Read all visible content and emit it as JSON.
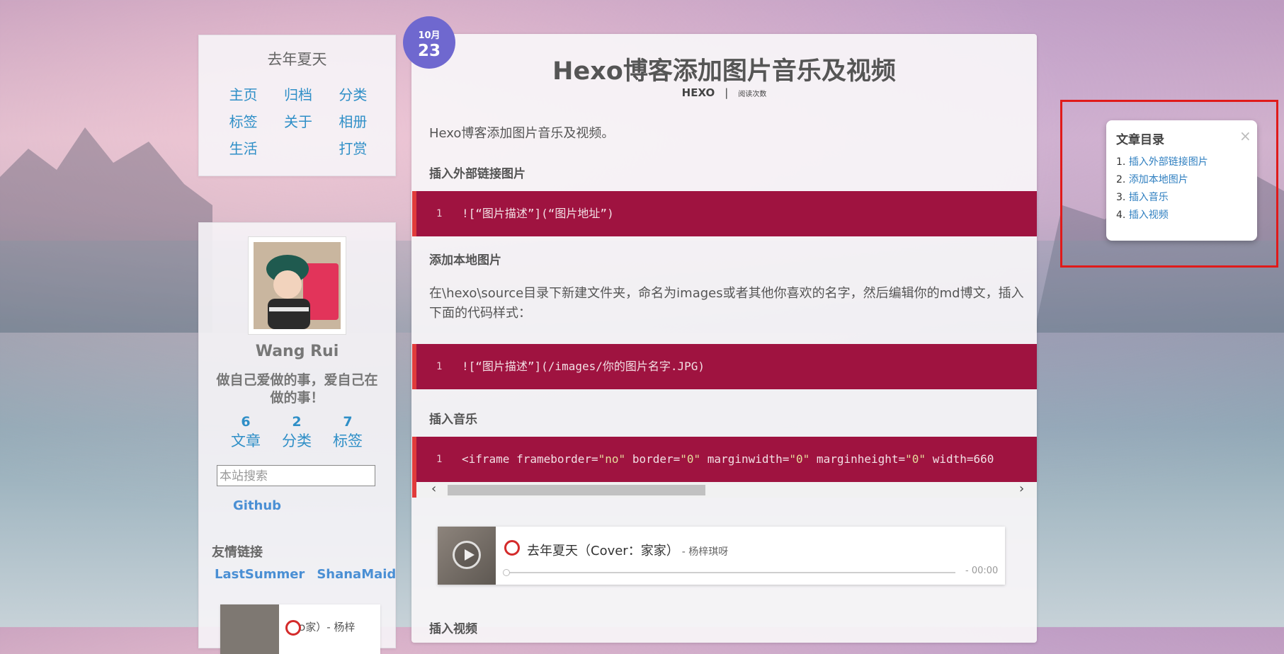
{
  "site": {
    "title": "去年夏天",
    "nav": [
      "主页",
      "归档",
      "分类",
      "标签",
      "关于",
      "相册",
      "生活",
      "",
      "打赏"
    ]
  },
  "profile": {
    "name": "Wang Rui",
    "motto": "做自己爱做的事，爱自己在做的事！",
    "stats": [
      {
        "count": "6",
        "label": "文章"
      },
      {
        "count": "2",
        "label": "分类"
      },
      {
        "count": "7",
        "label": "标签"
      }
    ],
    "search_placeholder": "本站搜索",
    "github_label": "Github",
    "friends_title": "友情链接",
    "friends": [
      "LastSummer",
      "ShanaMaid"
    ],
    "mini_player_text": "ɔ家）- 杨梓"
  },
  "post": {
    "date_month": "10月",
    "date_day": "23",
    "title": "Hexo博客添加图片音乐及视频",
    "tag": "HEXO",
    "separator": "|",
    "read_count_label": "阅读次数",
    "intro": "Hexo博客添加图片音乐及视频。",
    "sections": [
      {
        "heading": "插入外部链接图片"
      },
      {
        "heading": "添加本地图片",
        "text": "在\\hexo\\source目录下新建文件夹，命名为images或者其他你喜欢的名字，然后编辑你的md博文，插入下面的代码样式："
      },
      {
        "heading": "插入音乐"
      },
      {
        "heading": "插入视频"
      }
    ],
    "code_blocks": [
      {
        "line": "1",
        "code": "![“图片描述”](“图片地址”)"
      },
      {
        "line": "1",
        "code": "![“图片描述”](/images/你的图片名字.JPG)"
      },
      {
        "line": "1",
        "code": "<iframe frameborder=\"no\" border=\"0\" marginwidth=\"0\" marginheight=\"0\" width=660"
      }
    ],
    "player": {
      "song": "去年夏天（Cover：家家）",
      "artist": "- 杨梓琪呀",
      "time": "- 00:00",
      "progress": 0
    }
  },
  "toc": {
    "title": "文章目录",
    "close": "×",
    "items": [
      {
        "num": "1.",
        "label": "插入外部链接图片"
      },
      {
        "num": "2.",
        "label": "添加本地图片"
      },
      {
        "num": "3.",
        "label": "插入音乐"
      },
      {
        "num": "4.",
        "label": "插入视频"
      }
    ]
  },
  "colors": {
    "link": "#2f8fc7",
    "code_bg": "#9f1340",
    "code_border": "#e03b3b",
    "date_badge": "#6f68cf",
    "highlight_box": "#e01a1a"
  }
}
